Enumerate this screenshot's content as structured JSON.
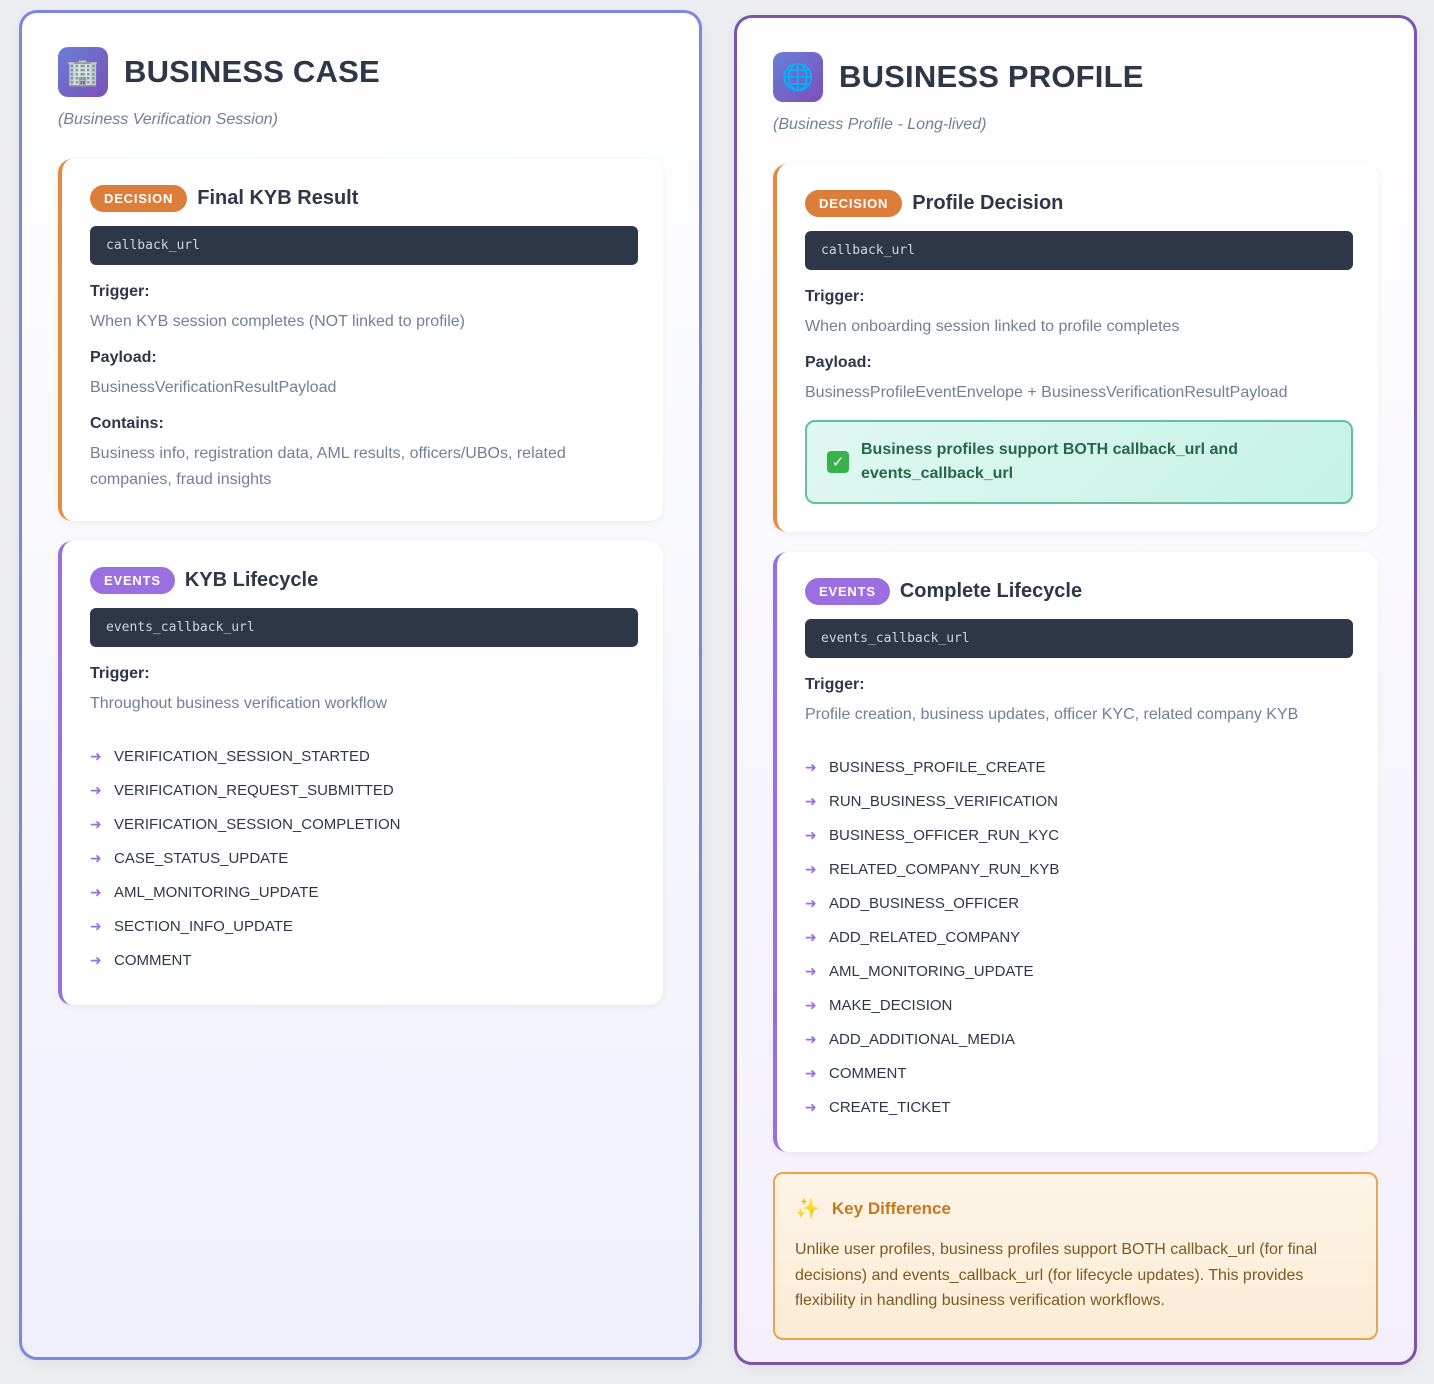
{
  "business_case": {
    "icon": "office-building-icon",
    "title": "BUSINESS CASE",
    "subtitle": "(Business Verification Session)",
    "decision_card": {
      "badge": "DECISION",
      "title": "Final KYB Result",
      "code": "callback_url",
      "trigger_label": "Trigger:",
      "trigger_value": "When KYB session completes (NOT linked to profile)",
      "payload_label": "Payload:",
      "payload_value": "BusinessVerificationResultPayload",
      "contains_label": "Contains:",
      "contains_value": "Business info, registration data, AML results, officers/UBOs, related companies, fraud insights"
    },
    "events_card": {
      "badge": "EVENTS",
      "title": "KYB Lifecycle",
      "code": "events_callback_url",
      "trigger_label": "Trigger:",
      "trigger_value": "Throughout business verification workflow",
      "events": [
        "VERIFICATION_SESSION_STARTED",
        "VERIFICATION_REQUEST_SUBMITTED",
        "VERIFICATION_SESSION_COMPLETION",
        "CASE_STATUS_UPDATE",
        "AML_MONITORING_UPDATE",
        "SECTION_INFO_UPDATE",
        "COMMENT"
      ]
    }
  },
  "business_profile": {
    "icon": "globe-icon",
    "title": "BUSINESS PROFILE",
    "subtitle": "(Business Profile - Long-lived)",
    "decision_card": {
      "badge": "DECISION",
      "title": "Profile Decision",
      "code": "callback_url",
      "trigger_label": "Trigger:",
      "trigger_value": "When onboarding session linked to profile completes",
      "payload_label": "Payload:",
      "payload_value": "BusinessProfileEventEnvelope + BusinessVerificationResultPayload",
      "note_icon": "check-mark-icon",
      "note": "Business profiles support BOTH callback_url and events_callback_url"
    },
    "events_card": {
      "badge": "EVENTS",
      "title": "Complete Lifecycle",
      "code": "events_callback_url",
      "trigger_label": "Trigger:",
      "trigger_value": "Profile creation, business updates, officer KYC, related company KYB",
      "events": [
        "BUSINESS_PROFILE_CREATE",
        "RUN_BUSINESS_VERIFICATION",
        "BUSINESS_OFFICER_RUN_KYC",
        "RELATED_COMPANY_RUN_KYB",
        "ADD_BUSINESS_OFFICER",
        "ADD_RELATED_COMPANY",
        "AML_MONITORING_UPDATE",
        "MAKE_DECISION",
        "ADD_ADDITIONAL_MEDIA",
        "COMMENT",
        "CREATE_TICKET"
      ]
    },
    "key_difference": {
      "icon": "sparkles-icon",
      "title": "Key Difference",
      "text": "Unlike user profiles, business profiles support BOTH callback_url (for final decisions) and events_callback_url (for lifecycle updates). This provides flexibility in handling business verification workflows."
    }
  },
  "colors": {
    "decision_accent": "#dd7d3a",
    "events_accent": "#9b6fe0",
    "case_border": "#7c88e0",
    "profile_border": "#7a55a8"
  }
}
